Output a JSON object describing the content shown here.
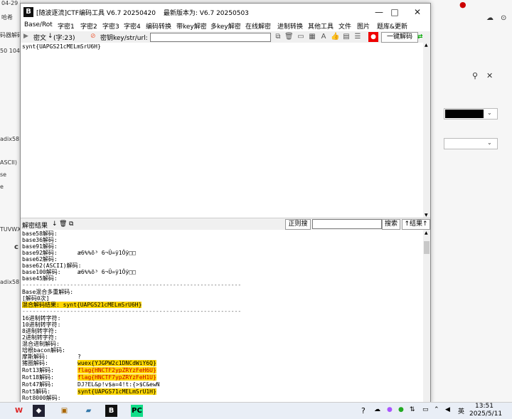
{
  "background": {
    "left_texts": [
      "04-29",
      "哈希",
      "码器解码",
      "50 104",
      "adix58)",
      "ASCII)",
      "se",
      "e",
      "TUVWX",
      "c",
      "adix58)"
    ],
    "right_icons": [
      "pin-icon",
      "close-icon",
      "chevron-down-icon",
      "chevron-down-icon"
    ]
  },
  "window": {
    "title": "[随波逐流]CTF编码工具 V6.7 20250420",
    "latest_version": "最新版本为:  V6.7  20250503",
    "app_icon_text": "B",
    "controls": {
      "minimize": "—",
      "maximize": "□",
      "close": "✕"
    }
  },
  "menu": [
    "Base/Rot",
    "字密1",
    "字密2",
    "字密3",
    "字密4",
    "编码转换",
    "带key解密",
    "多key解密",
    "在线解密",
    "进制转换",
    "其他工具",
    "文件",
    "图片",
    "题库&更新"
  ],
  "toolbar": {
    "input_label": "密文",
    "char_count": "(字:23)",
    "key_label": "密钥key/str/url:",
    "key_value": "",
    "decode_button": "一键解码"
  },
  "input": {
    "text": "synt{UAPGS21cMELmSrU6H}"
  },
  "result_bar": {
    "label": "解密结果",
    "regex_button": "正则搜",
    "search_button": "搜索",
    "result_button": "结果"
  },
  "output_lines": [
    {
      "label": "base58解码:",
      "value": ""
    },
    {
      "label": "base36解码:",
      "value": ""
    },
    {
      "label": "base91解码:",
      "value": ""
    },
    {
      "label": "base92解码:",
      "value": "æ6%%õ³ 6¬Ü=ÿ1Ôÿ□□"
    },
    {
      "label": "base62解码:",
      "value": ""
    },
    {
      "label": "base62(ASCII)解码:",
      "value": ""
    },
    {
      "label": "base100解码:",
      "value": "æ6%%õ³ 6¬Ü=ÿ1Ôÿ□□"
    },
    {
      "label": "base45解码:",
      "value": ""
    },
    {
      "label": "----------------------------------------------------------------",
      "value": ""
    },
    {
      "label": "Base混合多重解码:",
      "value": ""
    },
    {
      "label": "[解码0次]",
      "value": ""
    },
    {
      "label": "混合解码结果: synt{UAPGS21cMELmSrU6H}",
      "value": ""
    },
    {
      "label": "----------------------------------------------------------------",
      "value": ""
    },
    {
      "label": "16进制转字符:",
      "value": ""
    },
    {
      "label": "10进制转字符:",
      "value": ""
    },
    {
      "label": "8进制转字符:",
      "value": ""
    },
    {
      "label": "2进制转字符:",
      "value": ""
    },
    {
      "label": "混合进制解码:",
      "value": ""
    },
    {
      "label": "培根bacon解码:",
      "value": ""
    },
    {
      "label": "摩斯解码:",
      "value": "?"
    },
    {
      "label": "猪圈解码:",
      "value": "wuex{YJGPW2c1DNCdWiY6Q}"
    },
    {
      "label": "Rot13解码:",
      "value": "flag{HNCTF2ypZRYzFeH6U}"
    },
    {
      "label": "Rot18解码:",
      "value": "flag{HNCTF7ypZRYzFeH1U}"
    },
    {
      "label": "Rot47解码:",
      "value": "DJ?EL&p!v$a=4!t:{>$C&ewN"
    },
    {
      "label": "Rot5解码:",
      "value": "synt{UAPGS71cMELmSrU1H}"
    },
    {
      "label": "Rot8000解码:",
      "value": ""
    }
  ],
  "taskbar": {
    "time": "13:51",
    "date": "2025/5/11",
    "ime": "英",
    "apps": [
      "wps-icon",
      "shield-app-icon",
      "browser-icon",
      "files-icon",
      "bugku-icon",
      "pycharm-icon"
    ]
  }
}
